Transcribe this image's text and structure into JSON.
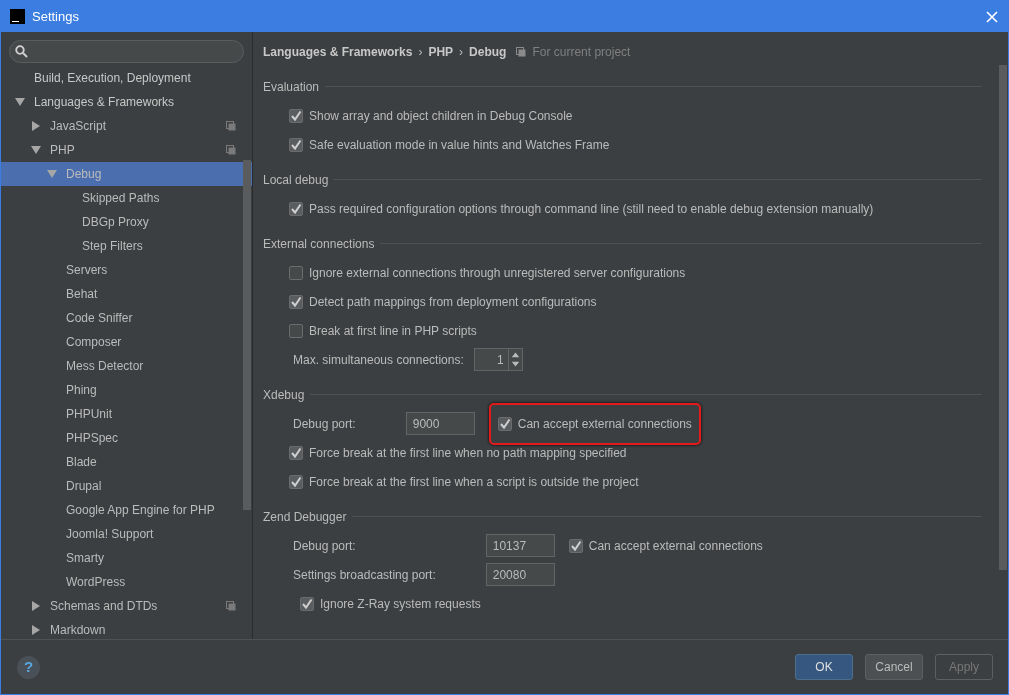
{
  "window": {
    "title": "Settings"
  },
  "help": "?",
  "sidebar": {
    "tree": [
      {
        "label": "Build, Execution, Deployment",
        "selected": false,
        "project_level": false
      },
      {
        "label": "Languages & Frameworks",
        "expanded": true,
        "selected": false,
        "project_level": false,
        "children": [
          {
            "label": "JavaScript",
            "expanded": false,
            "selected": false,
            "project_level": true
          },
          {
            "label": "PHP",
            "expanded": true,
            "selected": false,
            "project_level": true,
            "children": [
              {
                "label": "Debug",
                "expanded": true,
                "selected": true,
                "project_level": false,
                "children": [
                  {
                    "label": "Skipped Paths",
                    "selected": false,
                    "project_level": false
                  },
                  {
                    "label": "DBGp Proxy",
                    "selected": false,
                    "project_level": false
                  },
                  {
                    "label": "Step Filters",
                    "selected": false,
                    "project_level": false
                  }
                ]
              },
              {
                "label": "Servers",
                "selected": false,
                "project_level": false
              },
              {
                "label": "Behat",
                "selected": false,
                "project_level": false
              },
              {
                "label": "Code Sniffer",
                "selected": false,
                "project_level": false
              },
              {
                "label": "Composer",
                "selected": false,
                "project_level": false
              },
              {
                "label": "Mess Detector",
                "selected": false,
                "project_level": false
              },
              {
                "label": "Phing",
                "selected": false,
                "project_level": false
              },
              {
                "label": "PHPUnit",
                "selected": false,
                "project_level": false
              },
              {
                "label": "PHPSpec",
                "selected": false,
                "project_level": false
              },
              {
                "label": "Blade",
                "selected": false,
                "project_level": false
              },
              {
                "label": "Drupal",
                "selected": false,
                "project_level": false
              },
              {
                "label": "Google App Engine for PHP",
                "selected": false,
                "project_level": false
              },
              {
                "label": "Joomla! Support",
                "selected": false,
                "project_level": false
              },
              {
                "label": "Smarty",
                "selected": false,
                "project_level": false
              },
              {
                "label": "WordPress",
                "selected": false,
                "project_level": false
              }
            ]
          },
          {
            "label": "Schemas and DTDs",
            "expanded": false,
            "selected": false,
            "project_level": true
          },
          {
            "label": "Markdown",
            "expanded": false,
            "selected": false,
            "project_level": false
          }
        ]
      }
    ]
  },
  "breadcrumb": [
    "Languages & Frameworks",
    "PHP",
    "Debug"
  ],
  "breadcrumb_separators": [
    "›",
    "›"
  ],
  "scope": "For current project",
  "sections": [
    {
      "title": "Evaluation",
      "rows": [
        {
          "kind": "checkbox",
          "label": "Show array and object children in Debug Console",
          "checked": true
        },
        {
          "kind": "checkbox",
          "label": "Safe evaluation mode in value hints and Watches Frame",
          "checked": true
        }
      ]
    },
    {
      "title": "Local debug",
      "rows": [
        {
          "kind": "checkbox",
          "label": "Pass required configuration options through command line (still need to enable debug extension manually)",
          "checked": true
        }
      ]
    },
    {
      "title": "External connections",
      "rows": [
        {
          "kind": "checkbox",
          "label": "Ignore external connections through unregistered server configurations",
          "checked": false
        },
        {
          "kind": "checkbox",
          "label": "Detect path mappings from deployment configurations",
          "checked": true
        },
        {
          "kind": "checkbox",
          "label": "Break at first line in PHP scripts",
          "checked": false
        },
        {
          "kind": "spinner",
          "label": "Max. simultaneous connections:",
          "value": "1"
        }
      ]
    },
    {
      "title": "Xdebug",
      "rows": [
        {
          "kind": "port",
          "label": "Debug port:",
          "value": "9000",
          "checkbox": {
            "label": "Can accept external connections",
            "checked": true,
            "highlighted": true
          }
        },
        {
          "kind": "checkbox",
          "label": "Force break at the first line when no path mapping specified",
          "checked": true
        },
        {
          "kind": "checkbox",
          "label": "Force break at the first line when a script is outside the project",
          "checked": true
        }
      ]
    },
    {
      "title": "Zend Debugger",
      "rows": [
        {
          "kind": "port",
          "label": "Debug port:",
          "value": "10137",
          "checkbox": {
            "label": "Can accept external connections",
            "checked": true,
            "highlighted": false
          }
        },
        {
          "kind": "port",
          "label": "Settings broadcasting port:",
          "value": "20080"
        },
        {
          "kind": "checkbox",
          "label": "Ignore Z-Ray system requests",
          "checked": true
        }
      ]
    }
  ],
  "buttons": [
    {
      "label": "OK",
      "kind": "default",
      "disabled": false
    },
    {
      "label": "Cancel",
      "kind": "normal",
      "disabled": false
    },
    {
      "label": "Apply",
      "kind": "normal",
      "disabled": true
    }
  ]
}
